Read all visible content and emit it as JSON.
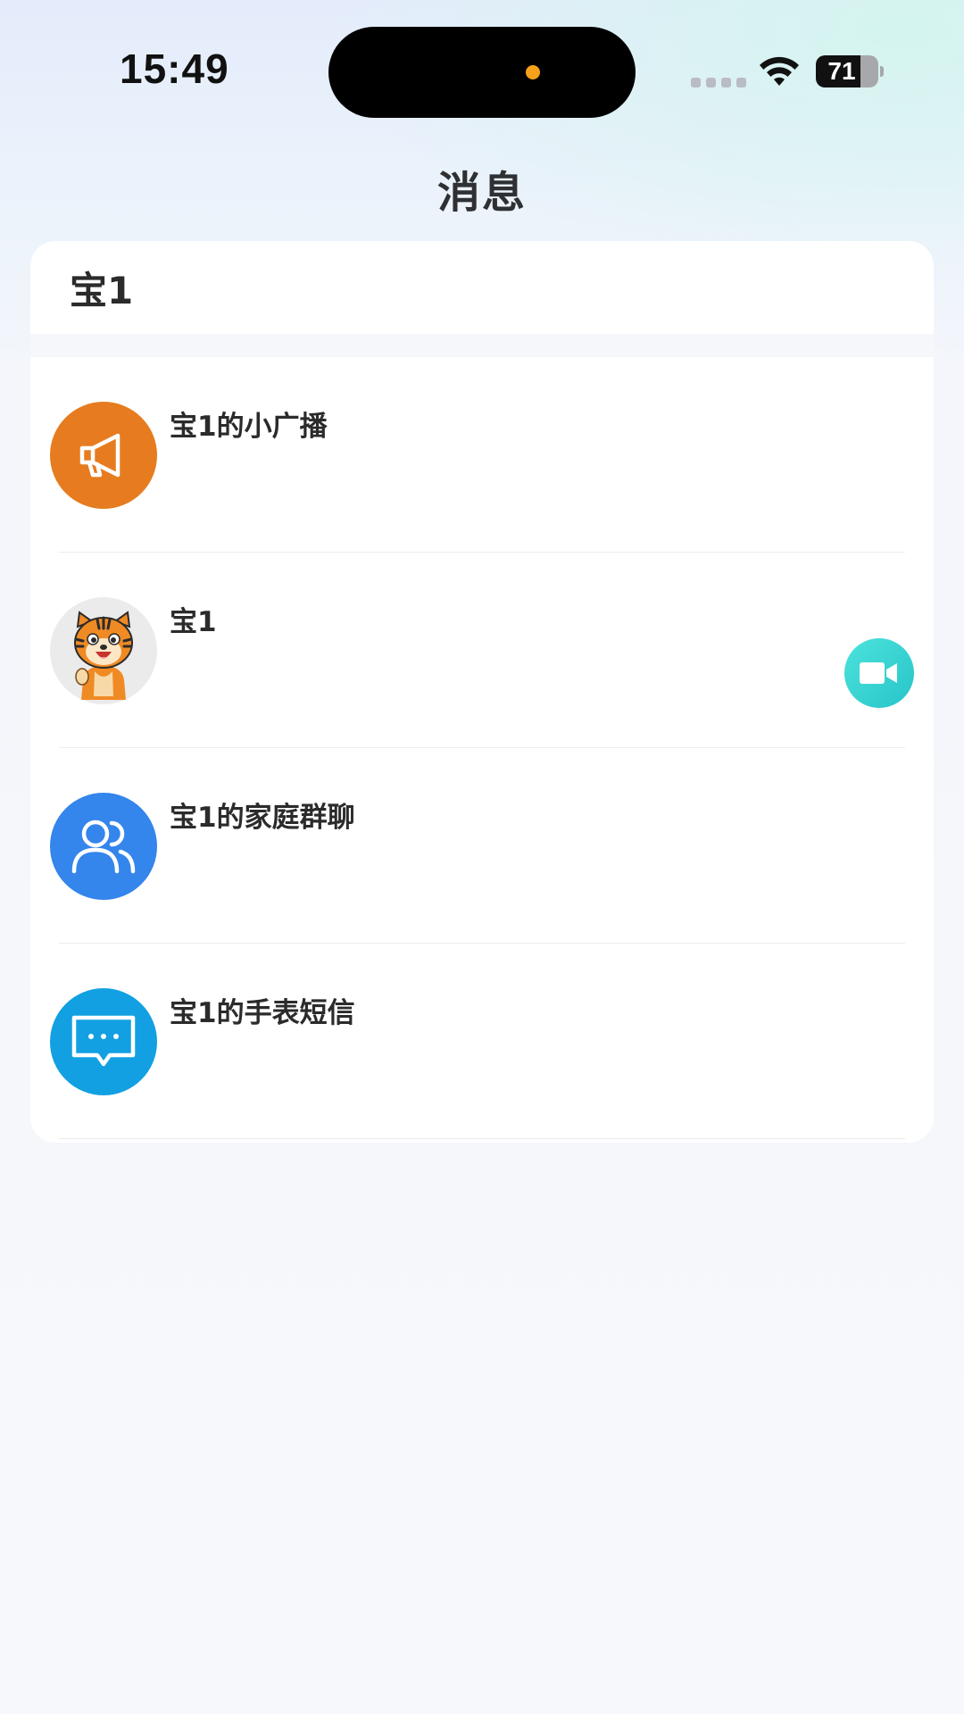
{
  "status_bar": {
    "time": "15:49",
    "battery_level": "71",
    "battery_percent": 71
  },
  "header": {
    "title": "消息"
  },
  "card": {
    "device_name": "宝1",
    "items": [
      {
        "title": "宝1的小广播",
        "icon": "megaphone-icon",
        "color": "#e67c1f"
      },
      {
        "title": "宝1",
        "icon": "tiger-avatar",
        "color": "#ebebeb",
        "action_icon": "video-camera-icon"
      },
      {
        "title": "宝1的家庭群聊",
        "icon": "group-users-icon",
        "color": "#3485ec"
      },
      {
        "title": "宝1的手表短信",
        "icon": "message-bubble-icon",
        "color": "#12a0e2"
      }
    ]
  },
  "colors": {
    "accent_teal": "#33cfd0",
    "text_primary": "#2b2b2b"
  }
}
